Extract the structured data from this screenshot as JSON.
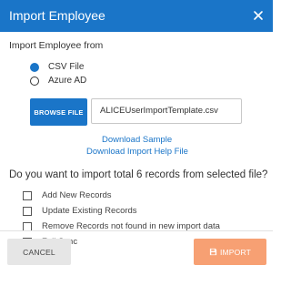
{
  "dialog": {
    "title": "Import Employee",
    "close_icon": "close-icon"
  },
  "source": {
    "label": "Import Employee from",
    "options": [
      {
        "label": "CSV File",
        "selected": true
      },
      {
        "label": "Azure AD",
        "selected": false
      }
    ]
  },
  "file": {
    "browse_label": "BROWSE FILE",
    "filename": "ALICEUserImportTemplate.csv"
  },
  "links": {
    "download_sample": "Download Sample",
    "download_help": "Download Import Help File"
  },
  "question": "Do you want to import total 6 records from selected file?",
  "import_options": [
    {
      "label": "Add New Records",
      "checked": false
    },
    {
      "label": "Update Existing Records",
      "checked": false
    },
    {
      "label": "Remove Records not found in new import data",
      "checked": false
    },
    {
      "label": "Full Sync",
      "checked": false
    }
  ],
  "footer": {
    "cancel_label": "CANCEL",
    "import_label": "IMPORT",
    "import_icon": "save-icon"
  },
  "colors": {
    "primary": "#1a75c8",
    "import_button": "#f7a073",
    "cancel_button": "#e6e6e6"
  }
}
